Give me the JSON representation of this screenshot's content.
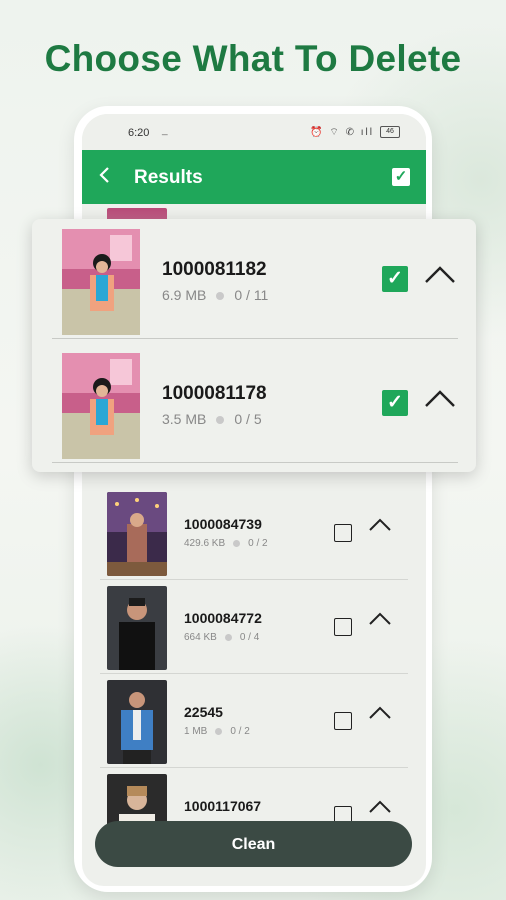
{
  "headline": "Choose What To Delete",
  "status_bar": {
    "time": "6:20",
    "indicator": "_",
    "icons": "⏰ ⌔ ✆ ıll",
    "battery": "46"
  },
  "app_bar": {
    "back_icon": "back-arrow-icon",
    "title": "Results",
    "select_all_checked": true
  },
  "expanded_groups": [
    {
      "name": "1000081182",
      "size": "6.9 MB",
      "count": "0 / 11",
      "checked": true
    },
    {
      "name": "1000081178",
      "size": "3.5 MB",
      "count": "0 / 5",
      "checked": true
    }
  ],
  "groups": [
    {
      "name": "1000084739",
      "size": "429.6 KB",
      "count": "0 / 2",
      "checked": false
    },
    {
      "name": "1000084772",
      "size": "664 KB",
      "count": "0 / 4",
      "checked": false
    },
    {
      "name": "22545",
      "size": "1 MB",
      "count": "0 / 2",
      "checked": false
    },
    {
      "name": "1000117067",
      "size": "",
      "count": "",
      "checked": false
    }
  ],
  "clean_button": "Clean",
  "colors": {
    "brand_green": "#1fa75a",
    "headline_green": "#1e7a42",
    "button_dark": "#3b4a44"
  }
}
